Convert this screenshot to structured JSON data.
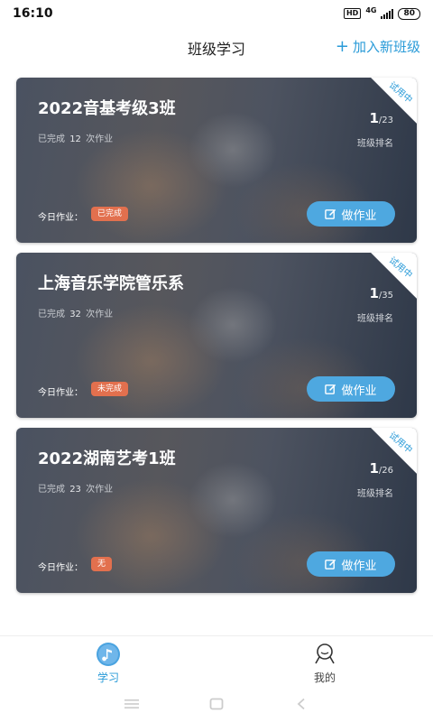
{
  "status_bar": {
    "time": "16:10",
    "hd": "HD",
    "network": "4G",
    "battery": "80"
  },
  "header": {
    "title": "班级学习",
    "join_plus": "+",
    "join_label": "加入新班级"
  },
  "cards": [
    {
      "ribbon": "试用中",
      "title": "2022音基考级3班",
      "progress_prefix": "已完成",
      "progress_count": "12",
      "progress_suffix": "次作业",
      "rank": "1",
      "rank_total": "/23",
      "rank_label": "班级排名",
      "today_label": "今日作业：",
      "homework_status": "已完成",
      "action_label": "做作业"
    },
    {
      "ribbon": "试用中",
      "title": "上海音乐学院管乐系",
      "progress_prefix": "已完成",
      "progress_count": "32",
      "progress_suffix": "次作业",
      "rank": "1",
      "rank_total": "/35",
      "rank_label": "班级排名",
      "today_label": "今日作业：",
      "homework_status": "未完成",
      "action_label": "做作业"
    },
    {
      "ribbon": "试用中",
      "title": "2022湖南艺考1班",
      "progress_prefix": "已完成",
      "progress_count": "23",
      "progress_suffix": "次作业",
      "rank": "1",
      "rank_total": "/26",
      "rank_label": "班级排名",
      "today_label": "今日作业：",
      "homework_status": "无",
      "action_label": "做作业"
    }
  ],
  "bottom_nav": [
    {
      "label": "学习",
      "icon": "music-note-icon",
      "active": true
    },
    {
      "label": "我的",
      "icon": "user-icon",
      "active": false
    }
  ],
  "colors": {
    "accent": "#2a9bd8",
    "button": "#4ea8e0",
    "badge": "#e2704e"
  }
}
